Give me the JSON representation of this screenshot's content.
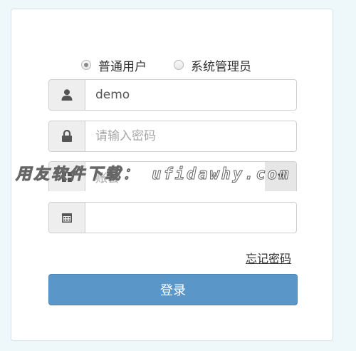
{
  "role": {
    "options": [
      {
        "label": "普通用户",
        "checked": true
      },
      {
        "label": "系统管理员",
        "checked": false
      }
    ]
  },
  "form": {
    "username": {
      "value": "demo",
      "icon": "user-icon"
    },
    "password": {
      "placeholder": "请输入密码",
      "icon": "lock-icon"
    },
    "account": {
      "value": "账套",
      "icon": "grid-icon",
      "arrow": "▼"
    },
    "date": {
      "value": "",
      "icon": "calendar-icon"
    }
  },
  "links": {
    "forgot_password": "忘记密码"
  },
  "buttons": {
    "login": "登录"
  },
  "watermark": "用友软件下载： ufidawhy.com",
  "colors": {
    "primary": "#5b96c9",
    "background": "#eef8fb",
    "addon": "#eeeeee"
  }
}
